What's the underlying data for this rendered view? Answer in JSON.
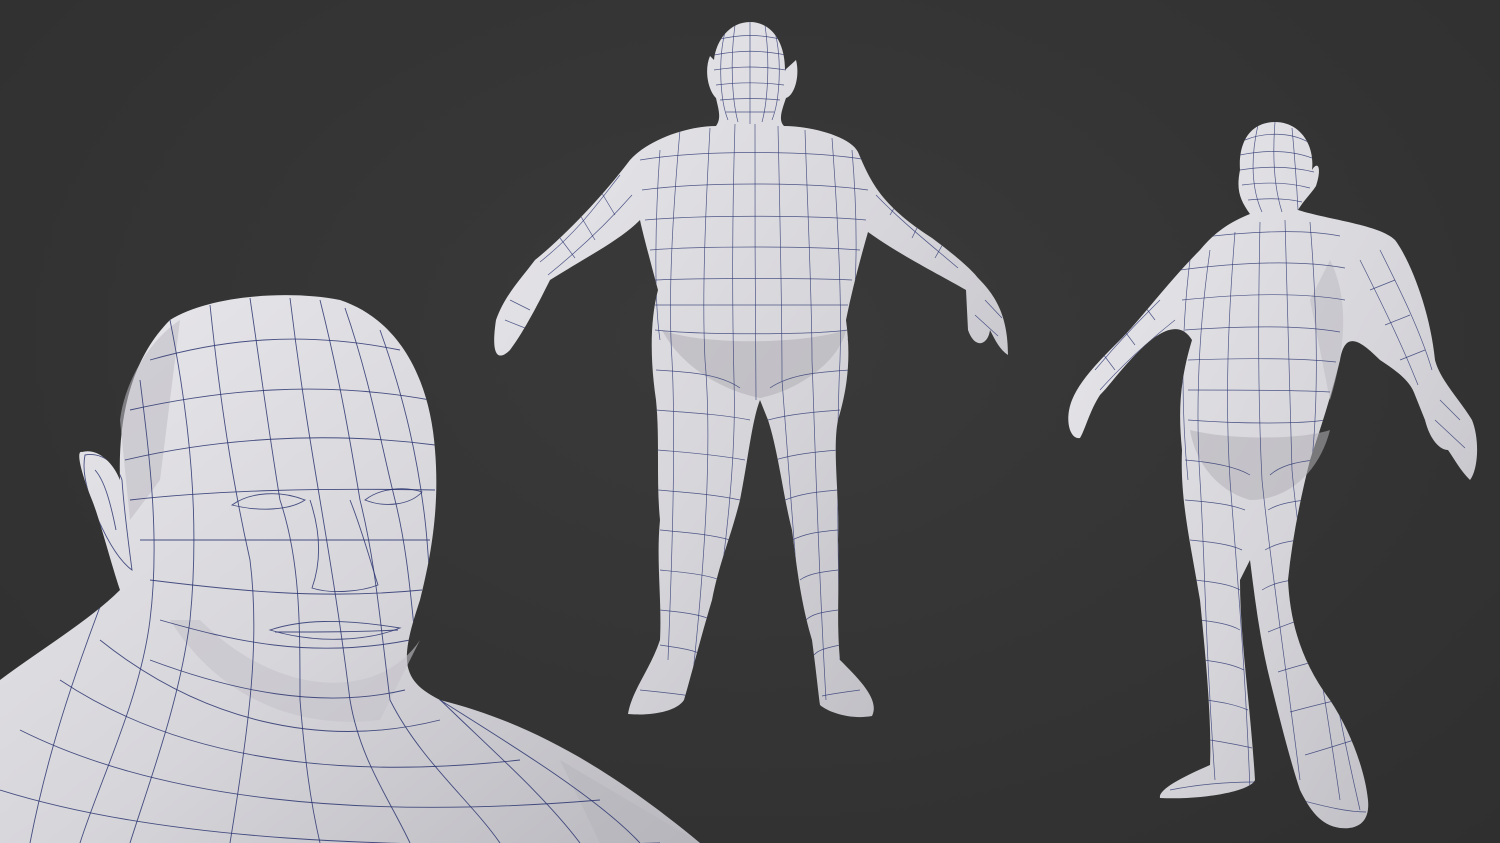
{
  "scene": {
    "background_color": "#333333",
    "mesh_color": "#d8d8dc",
    "wire_color": "#2a3470",
    "views": [
      {
        "name": "head-closeup-view",
        "kind": "close-up portrait"
      },
      {
        "name": "front-view",
        "kind": "front A-pose"
      },
      {
        "name": "three-quarter-view",
        "kind": "three-quarter A-pose"
      }
    ]
  }
}
